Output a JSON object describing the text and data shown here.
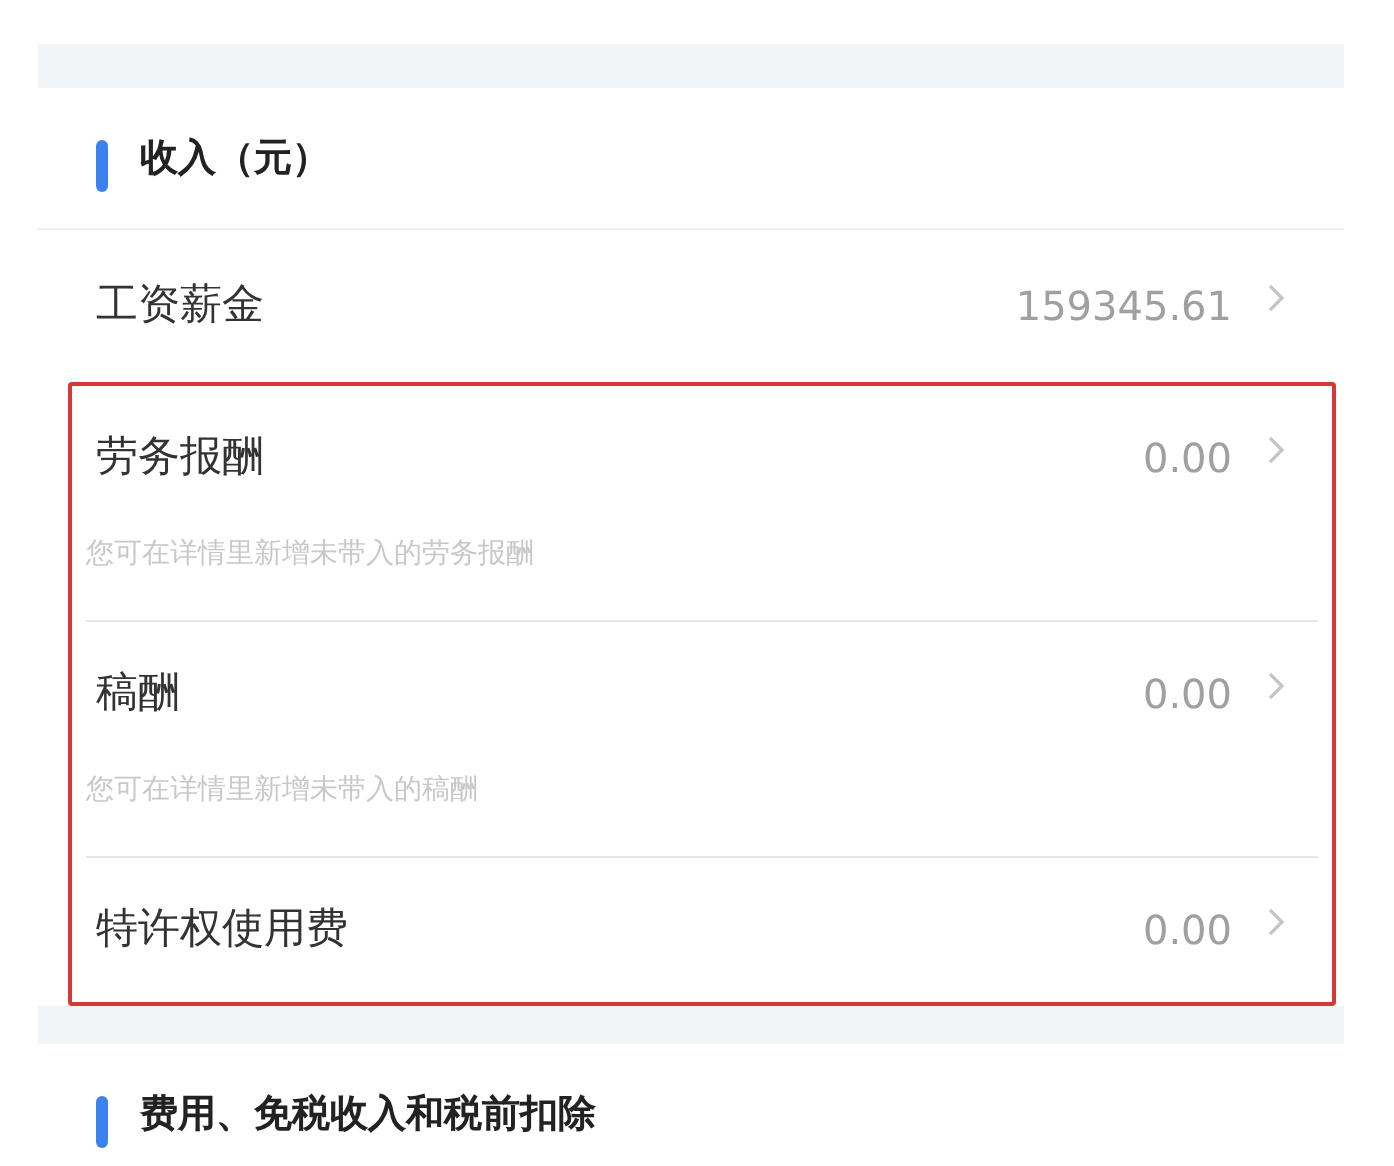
{
  "sections": [
    {
      "title": "收入（元）",
      "items": [
        {
          "label": "工资薪金",
          "value": "159345.61",
          "highlighted": false
        },
        {
          "label": "劳务报酬",
          "value": "0.00",
          "hint": "您可在详情里新增未带入的劳务报酬",
          "highlighted": true
        },
        {
          "label": "稿酬",
          "value": "0.00",
          "hint": "您可在详情里新增未带入的稿酬",
          "highlighted": true
        },
        {
          "label": "特许权使用费",
          "value": "0.00",
          "highlighted": true
        }
      ]
    },
    {
      "title": "费用、免税收入和税前扣除"
    }
  ]
}
